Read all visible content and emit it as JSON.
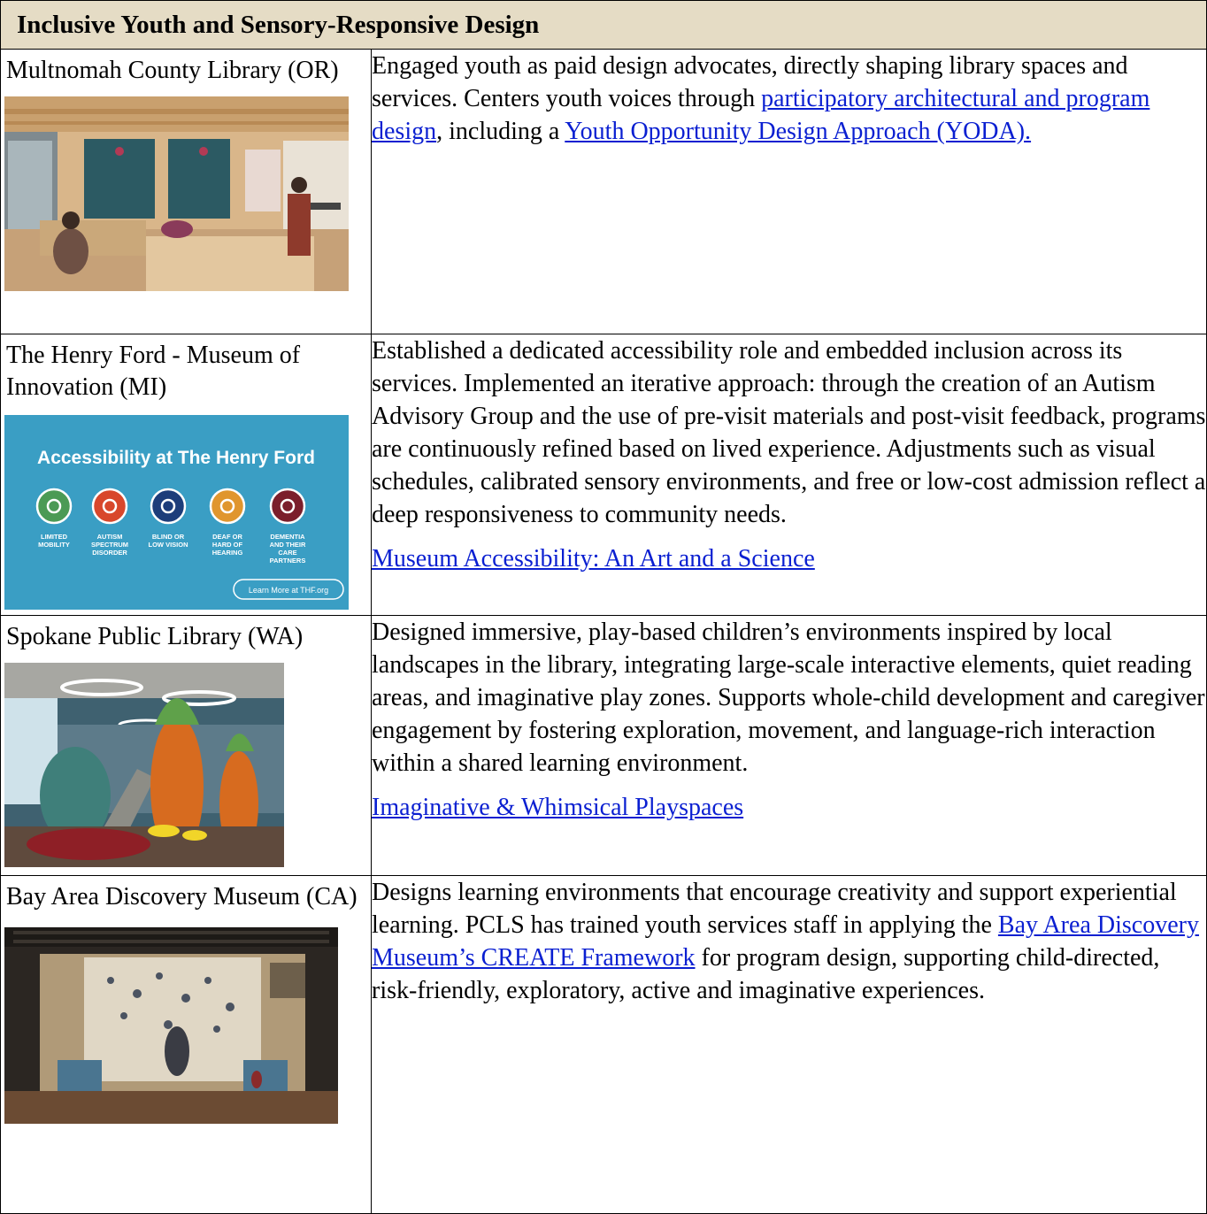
{
  "table": {
    "header": "Inclusive Youth and Sensory-Responsive Design",
    "rows": [
      {
        "name": "Multnomah County Library (OR)",
        "image": "library-youth-space-photo",
        "desc_a": "Engaged youth as paid design advocates, directly shaping library spaces and services. Centers youth voices through ",
        "link_a": "participatory architectural and program design",
        "desc_b": ", including a ",
        "link_b": "Youth Opportunity Design Approach (YODA)."
      },
      {
        "name": "The Henry Ford - Museum of Innovation (MI)",
        "image": {
          "title": "Accessibility at The Henry Ford",
          "icons": [
            {
              "label1": "LIMITED",
              "label2": "MOBILITY",
              "label3": "",
              "label4": "",
              "color": "#4b9a55"
            },
            {
              "label1": "AUTISM",
              "label2": "SPECTRUM",
              "label3": "DISORDER",
              "label4": "",
              "color": "#d8472b"
            },
            {
              "label1": "BLIND OR",
              "label2": "LOW VISION",
              "label3": "",
              "label4": "",
              "color": "#1d3d7a"
            },
            {
              "label1": "DEAF OR",
              "label2": "HARD OF",
              "label3": "HEARING",
              "label4": "",
              "color": "#e0962e"
            },
            {
              "label1": "DEMENTIA",
              "label2": "AND THEIR",
              "label3": "CARE",
              "label4": "PARTNERS",
              "color": "#7b1e2b"
            }
          ],
          "button": "Learn More at THF.org",
          "bg": "#3a9ec4"
        },
        "desc": "Established a dedicated accessibility role and embedded inclusion across its services. Implemented an iterative approach: through the creation of an Autism Advisory Group and the use of pre-visit materials and post-visit feedback, programs are continuously refined based on lived experience. Adjustments such as visual schedules, calibrated sensory environments, and free or low-cost admission reflect a deep responsiveness to community needs.",
        "link": "Museum Accessibility: An Art and a Science"
      },
      {
        "name": "Spokane Public Library (WA)",
        "image": "childrens-play-area-photo",
        "desc": "Designed immersive, play-based children’s environments inspired by local landscapes in the library, integrating large-scale interactive elements, quiet reading areas, and imaginative play zones. Supports whole-child development and caregiver engagement by fostering exploration, movement, and language-rich interaction within a shared learning environment.",
        "link": "Imaginative & Whimsical Playspaces"
      },
      {
        "name": "Bay Area Discovery Museum (CA)",
        "image": "discovery-museum-studio-photo",
        "desc_a": "Designs learning environments that encourage creativity and support experiential learning. PCLS has trained youth services staff in applying the ",
        "link_a": "Bay Area Discovery Museum’s CREATE Framework",
        "desc_b": " for program design, supporting child-directed, risk-friendly, exploratory, active and imaginative experiences."
      }
    ]
  }
}
